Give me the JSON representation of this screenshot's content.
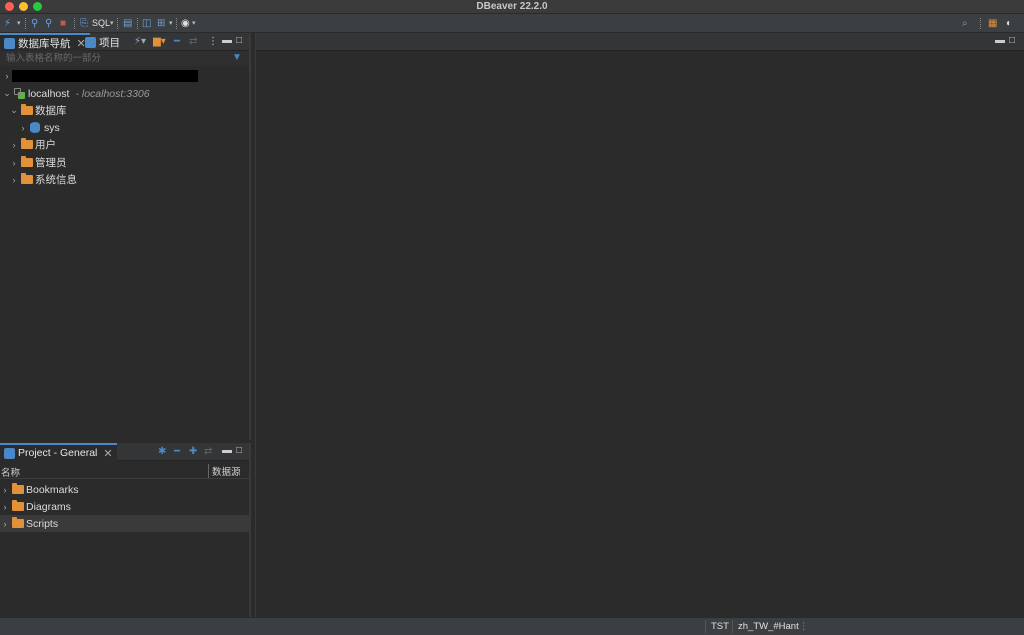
{
  "window": {
    "title": "DBeaver 22.2.0"
  },
  "toolbar": {
    "sql_label": "SQL"
  },
  "navigator": {
    "tab_label": "数据库导航",
    "projects_tab_label": "项目",
    "filter_placeholder": "输入表格名称的一部分",
    "tree": {
      "connection_label": "localhost",
      "connection_detail": "- localhost:3306",
      "databases_label": "数据库",
      "sys_label": "sys",
      "users_label": "用户",
      "admins_label": "管理员",
      "sysinfo_label": "系统信息"
    }
  },
  "project_panel": {
    "tab_label": "Project - General",
    "col_name": "名称",
    "col_datasource": "数据源",
    "items": [
      "Bookmarks",
      "Diagrams",
      "Scripts"
    ]
  },
  "statusbar": {
    "timezone": "TST",
    "locale": "zh_TW_#Hant"
  },
  "colors": {
    "accent": "#4a88c7",
    "folder": "#e0913a",
    "connected": "#5fb34a"
  }
}
